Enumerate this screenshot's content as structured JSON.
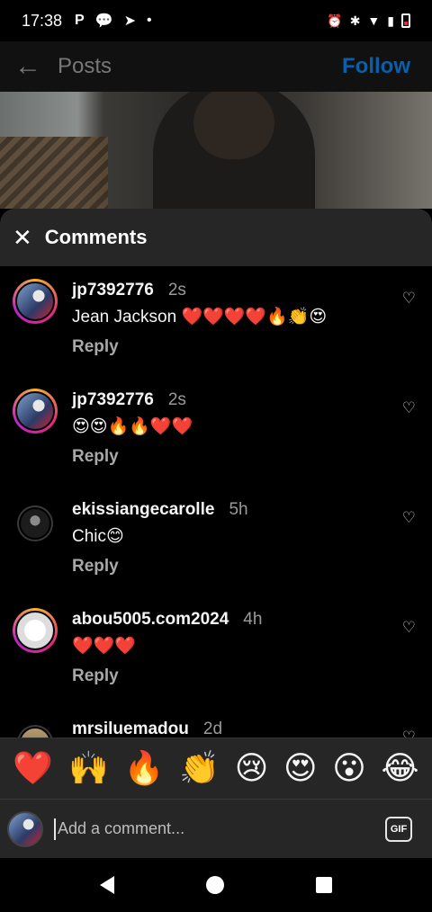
{
  "status_bar": {
    "time": "17:38",
    "left_icons": [
      "P",
      "chat-bubble",
      "telegram",
      "•"
    ],
    "right_icons": [
      "alarm-icon",
      "bluetooth-icon",
      "wifi-icon",
      "signal-icon",
      "battery-icon"
    ]
  },
  "header": {
    "title": "Posts",
    "follow_label": "Follow",
    "follow_color": "#0a5fa8"
  },
  "comments_panel": {
    "title": "Comments",
    "items": [
      {
        "username": "jp7392776",
        "time": "2s",
        "text": "Jean Jackson ❤️❤️❤️❤️🔥👏😍",
        "reply": "Reply",
        "avatar": "photo1",
        "ring": true
      },
      {
        "username": "jp7392776",
        "time": "2s",
        "text": "😍😍🔥🔥❤️❤️",
        "reply": "Reply",
        "avatar": "photo1",
        "ring": true
      },
      {
        "username": "ekissiangecarolle",
        "time": "5h",
        "text": "Chic😊",
        "reply": "Reply",
        "avatar": "photo2",
        "ring": false
      },
      {
        "username": "abou5005.com2024",
        "time": "4h",
        "text": "❤️❤️❤️",
        "reply": "Reply",
        "avatar": "blank",
        "ring": true
      },
      {
        "username": "mrsiluemadou",
        "time": "2d",
        "text": "",
        "reply": "",
        "avatar": "photo3",
        "ring": false
      }
    ]
  },
  "reactions": [
    "❤️",
    "🙌",
    "🔥",
    "👏",
    "😢",
    "😍",
    "😮",
    "😂"
  ],
  "composer": {
    "placeholder": "Add a comment...",
    "gif_label": "GIF"
  }
}
